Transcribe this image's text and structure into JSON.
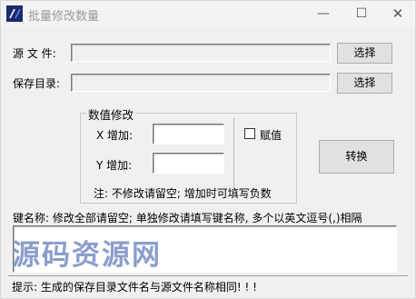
{
  "window": {
    "title": "批量修改数量",
    "min_glyph": "—",
    "max_glyph": "☐",
    "close_glyph": "✕"
  },
  "source_file": {
    "label": "源 文 件:",
    "value": "",
    "button": "选择"
  },
  "save_dir": {
    "label": "保存目录:",
    "value": "",
    "button": "选择"
  },
  "value_group": {
    "title": "数值修改",
    "x_label": "X 增加:",
    "x_value": "",
    "y_label": "Y 增加:",
    "y_value": "",
    "note": "注: 不修改请留空; 增加时可填写负数",
    "assign_label": "赋值",
    "assign_checked": false
  },
  "convert_button": "转换",
  "key_name": {
    "label": "键名称: 修改全部请留空; 单独修改请填写键名称, 多个以英文逗号(,)相隔",
    "value": ""
  },
  "watermark": "源码资源网",
  "tip": "提示: 生成的保存目录文件名与源文件名称相同! ! !"
}
